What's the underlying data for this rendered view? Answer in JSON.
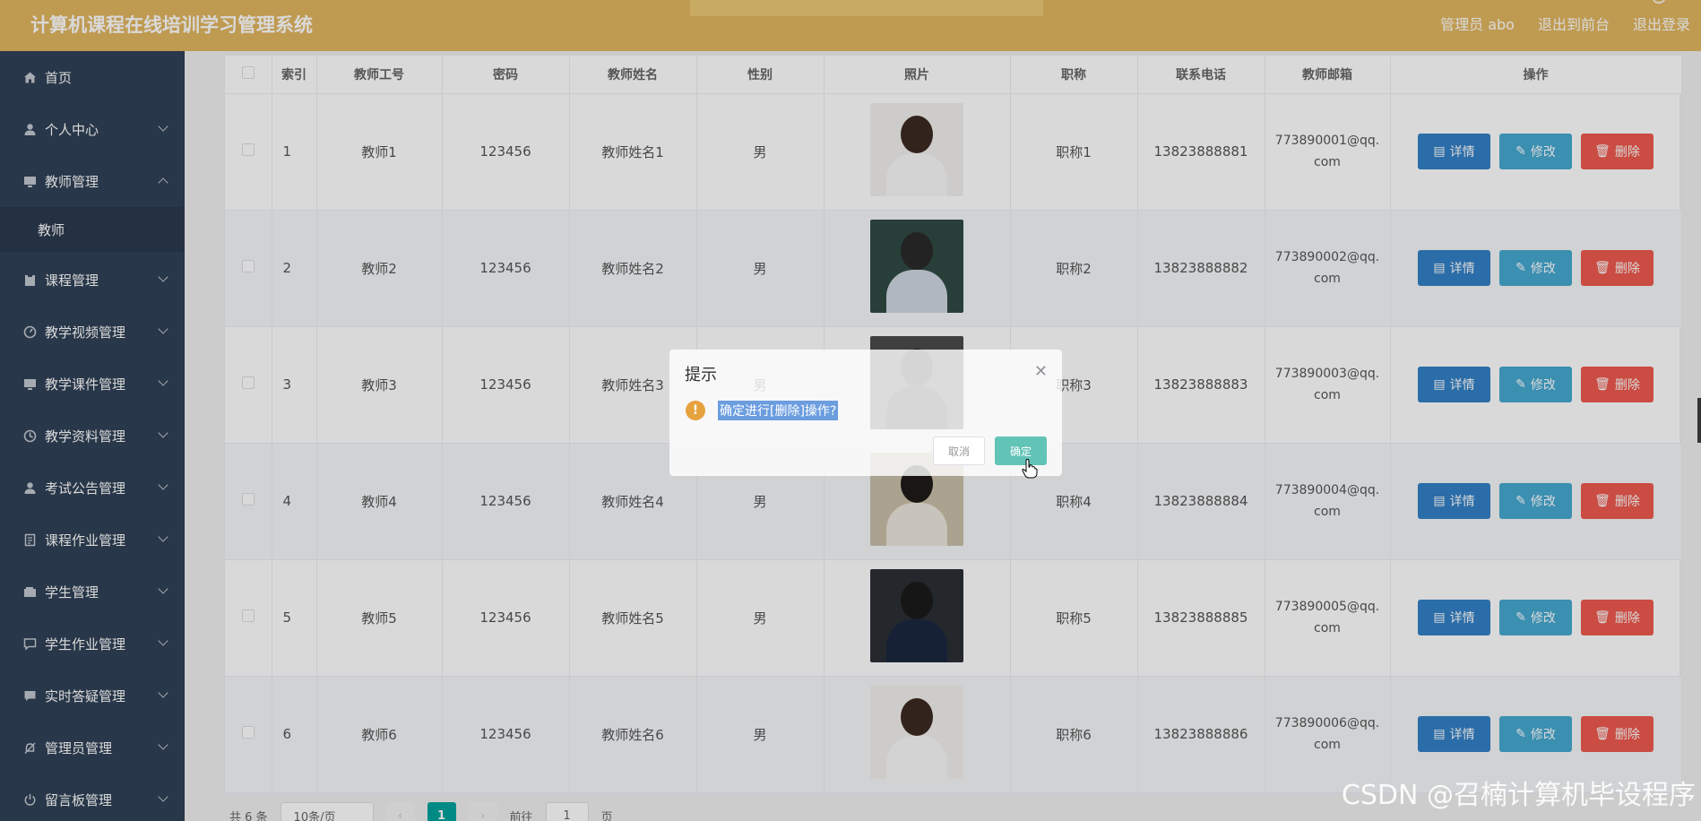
{
  "app": {
    "title": "计算机课程在线培训学习管理系统",
    "user": "管理员 abo",
    "nav": [
      "退出到前台",
      "退出登录"
    ]
  },
  "sidebar": {
    "items": [
      {
        "label": "首页",
        "icon": "home-icon"
      },
      {
        "label": "个人中心",
        "icon": "user-icon"
      },
      {
        "label": "教师管理",
        "icon": "monitor-icon",
        "expanded": true
      },
      {
        "label": "课程管理",
        "icon": "clipboard-icon"
      },
      {
        "label": "教学视频管理",
        "icon": "video-icon"
      },
      {
        "label": "教学课件管理",
        "icon": "monitor-icon"
      },
      {
        "label": "教学资料管理",
        "icon": "clock-icon"
      },
      {
        "label": "考试公告管理",
        "icon": "user-icon"
      },
      {
        "label": "课程作业管理",
        "icon": "document-icon"
      },
      {
        "label": "学生管理",
        "icon": "wallet-icon"
      },
      {
        "label": "学生作业管理",
        "icon": "chat-icon"
      },
      {
        "label": "实时答疑管理",
        "icon": "message-icon"
      },
      {
        "label": "管理员管理",
        "icon": "bell-off-icon"
      },
      {
        "label": "留言板管理",
        "icon": "power-icon"
      }
    ],
    "submenu": {
      "label": "教师"
    }
  },
  "table": {
    "headers": [
      "",
      "索引",
      "教师工号",
      "密码",
      "教师姓名",
      "性别",
      "照片",
      "职称",
      "联系电话",
      "教师邮箱",
      "操作"
    ],
    "rows": [
      {
        "index": "1",
        "id": "教师1",
        "pwd": "123456",
        "name": "教师姓名1",
        "gender": "男",
        "title": "职称1",
        "phone": "13823888881",
        "email1": "773890001@qq.",
        "email2": "com"
      },
      {
        "index": "2",
        "id": "教师2",
        "pwd": "123456",
        "name": "教师姓名2",
        "gender": "男",
        "title": "职称2",
        "phone": "13823888882",
        "email1": "773890002@qq.",
        "email2": "com"
      },
      {
        "index": "3",
        "id": "教师3",
        "pwd": "123456",
        "name": "教师姓名3",
        "gender": "男",
        "title": "职称3",
        "phone": "13823888883",
        "email1": "773890003@qq.",
        "email2": "com"
      },
      {
        "index": "4",
        "id": "教师4",
        "pwd": "123456",
        "name": "教师姓名4",
        "gender": "男",
        "title": "职称4",
        "phone": "13823888884",
        "email1": "773890004@qq.",
        "email2": "com"
      },
      {
        "index": "5",
        "id": "教师5",
        "pwd": "123456",
        "name": "教师姓名5",
        "gender": "男",
        "title": "职称5",
        "phone": "13823888885",
        "email1": "773890005@qq.",
        "email2": "com"
      },
      {
        "index": "6",
        "id": "教师6",
        "pwd": "123456",
        "name": "教师姓名6",
        "gender": "男",
        "title": "职称6",
        "phone": "13823888886",
        "email1": "773890006@qq.",
        "email2": "com"
      }
    ],
    "actions": {
      "detail": "详情",
      "edit": "修改",
      "delete": "删除"
    }
  },
  "pager": {
    "total": "共 6 条",
    "size": "10条/页",
    "current": "1",
    "goto": "前往",
    "goto_value": "1",
    "page_suffix": "页"
  },
  "dialog": {
    "title": "提示",
    "message": "确定进行[删除]操作?",
    "cancel": "取消",
    "confirm": "确定"
  },
  "watermark": "CSDN @召楠计算机毕设程序"
}
